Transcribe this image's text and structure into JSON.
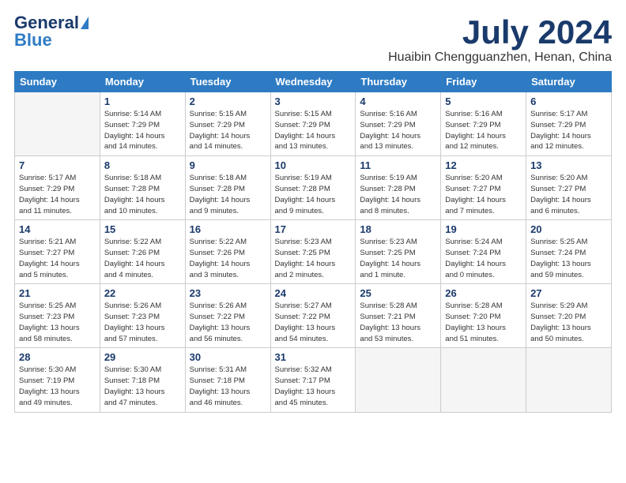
{
  "header": {
    "logo_general": "General",
    "logo_blue": "Blue",
    "month_title": "July 2024",
    "location": "Huaibin Chengguanzhen, Henan, China"
  },
  "days_of_week": [
    "Sunday",
    "Monday",
    "Tuesday",
    "Wednesday",
    "Thursday",
    "Friday",
    "Saturday"
  ],
  "weeks": [
    [
      {
        "day": "",
        "info": ""
      },
      {
        "day": "1",
        "info": "Sunrise: 5:14 AM\nSunset: 7:29 PM\nDaylight: 14 hours\nand 14 minutes."
      },
      {
        "day": "2",
        "info": "Sunrise: 5:15 AM\nSunset: 7:29 PM\nDaylight: 14 hours\nand 14 minutes."
      },
      {
        "day": "3",
        "info": "Sunrise: 5:15 AM\nSunset: 7:29 PM\nDaylight: 14 hours\nand 13 minutes."
      },
      {
        "day": "4",
        "info": "Sunrise: 5:16 AM\nSunset: 7:29 PM\nDaylight: 14 hours\nand 13 minutes."
      },
      {
        "day": "5",
        "info": "Sunrise: 5:16 AM\nSunset: 7:29 PM\nDaylight: 14 hours\nand 12 minutes."
      },
      {
        "day": "6",
        "info": "Sunrise: 5:17 AM\nSunset: 7:29 PM\nDaylight: 14 hours\nand 12 minutes."
      }
    ],
    [
      {
        "day": "7",
        "info": "Sunrise: 5:17 AM\nSunset: 7:29 PM\nDaylight: 14 hours\nand 11 minutes."
      },
      {
        "day": "8",
        "info": "Sunrise: 5:18 AM\nSunset: 7:28 PM\nDaylight: 14 hours\nand 10 minutes."
      },
      {
        "day": "9",
        "info": "Sunrise: 5:18 AM\nSunset: 7:28 PM\nDaylight: 14 hours\nand 9 minutes."
      },
      {
        "day": "10",
        "info": "Sunrise: 5:19 AM\nSunset: 7:28 PM\nDaylight: 14 hours\nand 9 minutes."
      },
      {
        "day": "11",
        "info": "Sunrise: 5:19 AM\nSunset: 7:28 PM\nDaylight: 14 hours\nand 8 minutes."
      },
      {
        "day": "12",
        "info": "Sunrise: 5:20 AM\nSunset: 7:27 PM\nDaylight: 14 hours\nand 7 minutes."
      },
      {
        "day": "13",
        "info": "Sunrise: 5:20 AM\nSunset: 7:27 PM\nDaylight: 14 hours\nand 6 minutes."
      }
    ],
    [
      {
        "day": "14",
        "info": "Sunrise: 5:21 AM\nSunset: 7:27 PM\nDaylight: 14 hours\nand 5 minutes."
      },
      {
        "day": "15",
        "info": "Sunrise: 5:22 AM\nSunset: 7:26 PM\nDaylight: 14 hours\nand 4 minutes."
      },
      {
        "day": "16",
        "info": "Sunrise: 5:22 AM\nSunset: 7:26 PM\nDaylight: 14 hours\nand 3 minutes."
      },
      {
        "day": "17",
        "info": "Sunrise: 5:23 AM\nSunset: 7:25 PM\nDaylight: 14 hours\nand 2 minutes."
      },
      {
        "day": "18",
        "info": "Sunrise: 5:23 AM\nSunset: 7:25 PM\nDaylight: 14 hours\nand 1 minute."
      },
      {
        "day": "19",
        "info": "Sunrise: 5:24 AM\nSunset: 7:24 PM\nDaylight: 14 hours\nand 0 minutes."
      },
      {
        "day": "20",
        "info": "Sunrise: 5:25 AM\nSunset: 7:24 PM\nDaylight: 13 hours\nand 59 minutes."
      }
    ],
    [
      {
        "day": "21",
        "info": "Sunrise: 5:25 AM\nSunset: 7:23 PM\nDaylight: 13 hours\nand 58 minutes."
      },
      {
        "day": "22",
        "info": "Sunrise: 5:26 AM\nSunset: 7:23 PM\nDaylight: 13 hours\nand 57 minutes."
      },
      {
        "day": "23",
        "info": "Sunrise: 5:26 AM\nSunset: 7:22 PM\nDaylight: 13 hours\nand 56 minutes."
      },
      {
        "day": "24",
        "info": "Sunrise: 5:27 AM\nSunset: 7:22 PM\nDaylight: 13 hours\nand 54 minutes."
      },
      {
        "day": "25",
        "info": "Sunrise: 5:28 AM\nSunset: 7:21 PM\nDaylight: 13 hours\nand 53 minutes."
      },
      {
        "day": "26",
        "info": "Sunrise: 5:28 AM\nSunset: 7:20 PM\nDaylight: 13 hours\nand 51 minutes."
      },
      {
        "day": "27",
        "info": "Sunrise: 5:29 AM\nSunset: 7:20 PM\nDaylight: 13 hours\nand 50 minutes."
      }
    ],
    [
      {
        "day": "28",
        "info": "Sunrise: 5:30 AM\nSunset: 7:19 PM\nDaylight: 13 hours\nand 49 minutes."
      },
      {
        "day": "29",
        "info": "Sunrise: 5:30 AM\nSunset: 7:18 PM\nDaylight: 13 hours\nand 47 minutes."
      },
      {
        "day": "30",
        "info": "Sunrise: 5:31 AM\nSunset: 7:18 PM\nDaylight: 13 hours\nand 46 minutes."
      },
      {
        "day": "31",
        "info": "Sunrise: 5:32 AM\nSunset: 7:17 PM\nDaylight: 13 hours\nand 45 minutes."
      },
      {
        "day": "",
        "info": ""
      },
      {
        "day": "",
        "info": ""
      },
      {
        "day": "",
        "info": ""
      }
    ]
  ]
}
